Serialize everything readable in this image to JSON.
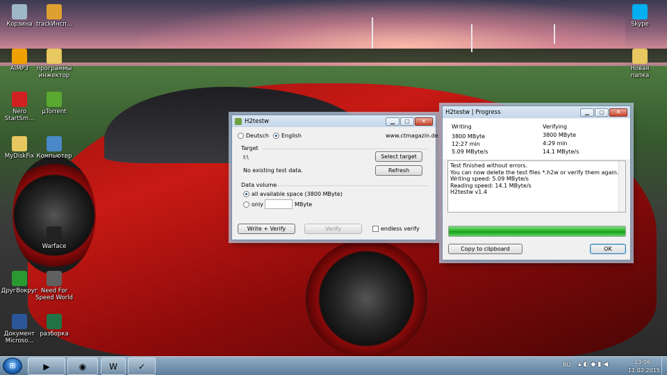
{
  "desktop_icons": [
    {
      "label": "Корзина",
      "icon": "recycle-bin-icon",
      "color": "#9fb8c8"
    },
    {
      "label": "trackИнсп...",
      "icon": "shortcut-icon",
      "color": "#e0a030"
    },
    {
      "label": "AIMP3",
      "icon": "aimp-icon",
      "color": "#f0a000"
    },
    {
      "label": "программы инжектор",
      "icon": "folder-icon",
      "color": "#e8c860"
    },
    {
      "label": "Nero StartSm...",
      "icon": "nero-icon",
      "color": "#d02020"
    },
    {
      "label": "µTorrent",
      "icon": "utorrent-icon",
      "color": "#5aa830"
    },
    {
      "label": "MyDiskFix",
      "icon": "folder-icon",
      "color": "#e8c860"
    },
    {
      "label": "Компьютер",
      "icon": "computer-icon",
      "color": "#4a88c8"
    },
    {
      "label": "Warface",
      "icon": "warface-icon",
      "color": "#222222"
    },
    {
      "label": "ДругВокруг",
      "icon": "drugvokrug-icon",
      "color": "#2a9a30"
    },
    {
      "label": "Need For Speed World",
      "icon": "nfs-icon",
      "color": "#606060"
    },
    {
      "label": "Документ Microso...",
      "icon": "word-doc-icon",
      "color": "#2b579a"
    },
    {
      "label": "разборка",
      "icon": "excel-doc-icon",
      "color": "#217346"
    },
    {
      "label": "Skype",
      "icon": "skype-icon",
      "color": "#00aff0"
    },
    {
      "label": "Новая папка",
      "icon": "folder-icon",
      "color": "#e8c860"
    }
  ],
  "h2testw": {
    "title": "H2testw",
    "lang_deutsch": "Deutsch",
    "lang_english": "English",
    "site": "www.ctmagazin.de",
    "target_label": "Target",
    "target_path": "I:\\",
    "target_status": "No existing test data.",
    "select_target": "Select target",
    "refresh": "Refresh",
    "volume_label": "Data volume",
    "all_space": "all available space (3800 MByte)",
    "only": "only",
    "only_value": "",
    "mbyte": "MByte",
    "write_verify": "Write + Verify",
    "verify": "Verify",
    "endless": "endless verify"
  },
  "progress": {
    "title": "H2testw | Progress",
    "writing_label": "Writing",
    "writing_size": "3800 MByte",
    "writing_time": "12:27 min",
    "writing_speed": "5.09 MByte/s",
    "verifying_label": "Verifying",
    "verifying_size": "3800 MByte",
    "verifying_time": "4:29 min",
    "verifying_speed": "14.1 MByte/s",
    "log": [
      "Test finished without errors.",
      "You can now delete the test files *.h2w or verify them again.",
      "Writing speed: 5.09 MByte/s",
      "Reading speed: 14.1 MByte/s",
      "H2testw v1.4"
    ],
    "progress_fraction": 1.0,
    "copy_button": "Copy to clipboard",
    "ok_button": "OK"
  },
  "taskbar": {
    "apps": [
      {
        "name": "media-player",
        "icon": "media-player-icon",
        "glyph": "▶"
      },
      {
        "name": "chrome",
        "icon": "chrome-icon",
        "glyph": "◉"
      },
      {
        "name": "word",
        "icon": "word-icon",
        "glyph": "W"
      },
      {
        "name": "h2testw",
        "icon": "h2testw-icon",
        "glyph": "✓"
      }
    ],
    "lang": "RU",
    "time": "23:06",
    "date": "11.02.2015"
  }
}
